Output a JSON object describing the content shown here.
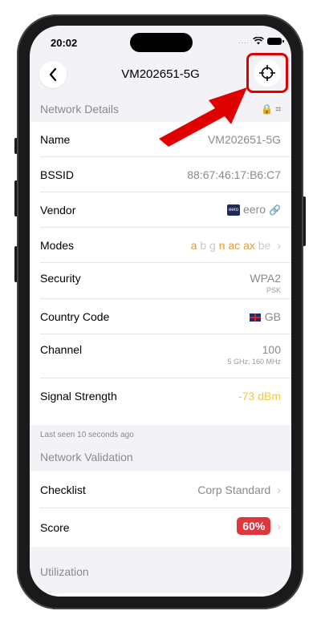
{
  "status": {
    "time": "20:02"
  },
  "navbar": {
    "title": "VM202651-5G"
  },
  "network_details": {
    "header": "Network Details",
    "name_label": "Name",
    "name_value": "VM202651-5G",
    "bssid_label": "BSSID",
    "bssid_value": "88:67:46:17:B6:C7",
    "vendor_label": "Vendor",
    "vendor_logo": "eero",
    "vendor_value": "eero",
    "modes_label": "Modes",
    "modes": [
      {
        "text": "a",
        "on": true
      },
      {
        "text": "b",
        "on": false
      },
      {
        "text": "g",
        "on": false
      },
      {
        "text": "n",
        "on": true
      },
      {
        "text": "ac",
        "on": true
      },
      {
        "text": "ax",
        "on": true
      },
      {
        "text": "be",
        "on": false
      }
    ],
    "security_label": "Security",
    "security_value": "WPA2",
    "security_sub": "PSK",
    "country_label": "Country Code",
    "country_value": "GB",
    "channel_label": "Channel",
    "channel_value": "100",
    "channel_sub": "5 GHz, 160 MHz",
    "signal_label": "Signal Strength",
    "signal_value": "-73 dBm"
  },
  "last_seen": "Last seen 10 seconds ago",
  "validation": {
    "header": "Network Validation",
    "checklist_label": "Checklist",
    "checklist_value": "Corp Standard",
    "score_label": "Score",
    "score_value": "60%"
  },
  "utilization": {
    "header": "Utilization"
  },
  "colors": {
    "accent_orange": "#e69a2e",
    "signal_yellow": "#f5c842",
    "score_red": "#e0353a",
    "highlight_red": "#e00000"
  }
}
